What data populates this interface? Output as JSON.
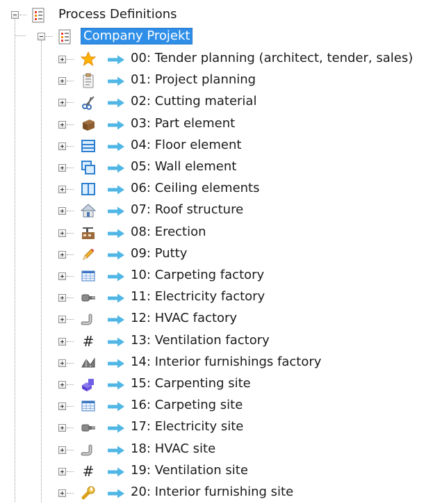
{
  "tree": {
    "root": {
      "label": "Process Definitions",
      "icon": "process-definitions-icon",
      "expanded": true
    },
    "project": {
      "label": "Company Projekt",
      "icon": "project-icon",
      "expanded": true,
      "selected": true
    },
    "items": [
      {
        "label": "00: Tender planning (architect, tender, sales)",
        "icon": "star-icon"
      },
      {
        "label": "01: Project planning",
        "icon": "clipboard-icon"
      },
      {
        "label": "02: Cutting material",
        "icon": "scissors-icon"
      },
      {
        "label": "03: Part element",
        "icon": "wood-block-icon"
      },
      {
        "label": "04: Floor element",
        "icon": "floor-panel-icon"
      },
      {
        "label": "05: Wall element",
        "icon": "wall-panels-icon"
      },
      {
        "label": "06: Ceiling elements",
        "icon": "ceiling-panel-icon"
      },
      {
        "label": "07: Roof structure",
        "icon": "house-icon"
      },
      {
        "label": "08: Erection",
        "icon": "crane-factory-icon"
      },
      {
        "label": "09: Putty",
        "icon": "pencil-icon"
      },
      {
        "label": "10: Carpeting factory",
        "icon": "table-grid-icon"
      },
      {
        "label": "11: Electricity factory",
        "icon": "plug-icon"
      },
      {
        "label": "12: HVAC factory",
        "icon": "pipe-icon"
      },
      {
        "label": "13: Ventilation factory",
        "icon": "hash-icon"
      },
      {
        "label": "14: Interior furnishings factory",
        "icon": "truss-icon"
      },
      {
        "label": "15: Carpenting site",
        "icon": "purple-blocks-icon"
      },
      {
        "label": "16: Carpeting site",
        "icon": "table-grid-icon"
      },
      {
        "label": "17: Electricity site",
        "icon": "plug-icon"
      },
      {
        "label": "18: HVAC site",
        "icon": "pipe-icon"
      },
      {
        "label": "19: Ventilation site",
        "icon": "hash-icon"
      },
      {
        "label": "20: Interior furnishing site",
        "icon": "wrench-icon"
      }
    ]
  },
  "colors": {
    "selection": "#2f8fe8",
    "arrow": "#4fb6e6",
    "tree_lines": "#9a9a9a"
  }
}
